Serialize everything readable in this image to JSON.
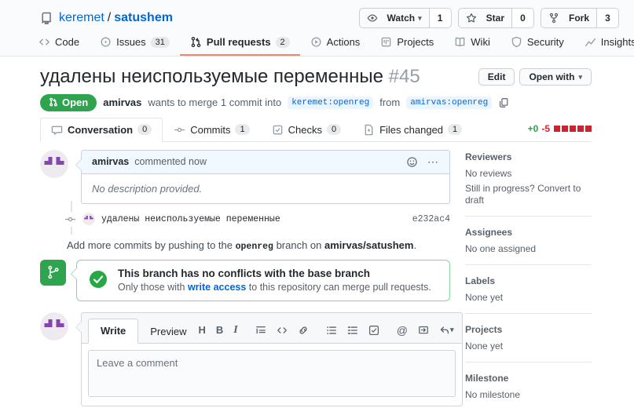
{
  "icons": {
    "caret_down": "▾",
    "kebab": "⋯",
    "heading_glyph": "H",
    "bold_glyph": "B",
    "italic_glyph": "I",
    "mention_glyph": "@",
    "names": [
      "repo-icon",
      "eye-icon",
      "star-icon",
      "fork-icon",
      "code-icon",
      "issue-icon",
      "pull-request-icon",
      "play-icon",
      "project-icon",
      "book-icon",
      "shield-icon",
      "graph-icon",
      "comment-icon",
      "commit-icon",
      "checks-icon",
      "file-diff-icon",
      "copy-icon",
      "smiley-icon",
      "kebab-icon",
      "check-circle-icon",
      "git-branch-icon",
      "quote-icon",
      "link-icon",
      "list-unordered-icon",
      "list-ordered-icon",
      "tasklist-icon",
      "cross-reference-icon",
      "reply-icon"
    ]
  },
  "header": {
    "repo": {
      "owner": "keremet",
      "separator": "/",
      "name": "satushem"
    },
    "watch": {
      "label": "Watch",
      "count": "1"
    },
    "star": {
      "label": "Star",
      "count": "0"
    },
    "fork": {
      "label": "Fork",
      "count": "3"
    },
    "nav": [
      {
        "label": "Code"
      },
      {
        "label": "Issues",
        "count": "31"
      },
      {
        "label": "Pull requests",
        "count": "2"
      },
      {
        "label": "Actions"
      },
      {
        "label": "Projects"
      },
      {
        "label": "Wiki"
      },
      {
        "label": "Security"
      },
      {
        "label": "Insights"
      }
    ]
  },
  "pr": {
    "title": "удалены неиспользуемые переменные",
    "number": "#45",
    "edit_button": "Edit",
    "open_with_button": "Open with",
    "state": "Open",
    "author": "amirvas",
    "merge_text_pre": "wants to merge 1 commit into",
    "base_ref": "keremet:openreg",
    "merge_text_mid": "from",
    "head_ref": "amirvas:openreg"
  },
  "pr_tabs": [
    {
      "label": "Conversation",
      "count": "0"
    },
    {
      "label": "Commits",
      "count": "1"
    },
    {
      "label": "Checks",
      "count": "0"
    },
    {
      "label": "Files changed",
      "count": "1"
    }
  ],
  "diffstat": {
    "additions": "+0",
    "deletions": "-5"
  },
  "conversation": {
    "comment": {
      "author": "amirvas",
      "meta": "commented now",
      "body": "No description provided."
    },
    "commit": {
      "message": "удалены неиспользуемые переменные",
      "sha": "e232ac4"
    },
    "push_hint": {
      "pre": "Add more commits by pushing to the",
      "branch": "openreg",
      "mid": "branch on",
      "repo": "amirvas/satushem",
      "post": "."
    },
    "merge_status": {
      "title": "This branch has no conflicts with the base branch",
      "note_pre": "Only those with",
      "note_link": "write access",
      "note_post": "to this repository can merge pull requests."
    }
  },
  "editor": {
    "write_tab": "Write",
    "preview_tab": "Preview",
    "placeholder": "Leave a comment"
  },
  "sidebar": {
    "reviewers": {
      "title": "Reviewers",
      "empty": "No reviews",
      "draft_pre": "Still in progress?",
      "draft_link": "Convert to draft"
    },
    "assignees": {
      "title": "Assignees",
      "empty": "No one assigned"
    },
    "labels": {
      "title": "Labels",
      "empty": "None yet"
    },
    "projects": {
      "title": "Projects",
      "empty": "None yet"
    },
    "milestone": {
      "title": "Milestone",
      "empty": "No milestone"
    }
  },
  "colors": {
    "open_green": "#2ea44f",
    "link_blue": "#0366d6",
    "tab_underline_orange": "#f9826c",
    "diff_red": "#cb2431",
    "diff_green": "#28a745",
    "branch_label_bg": "#eaf5ff",
    "header_bg": "#fafbfc"
  }
}
